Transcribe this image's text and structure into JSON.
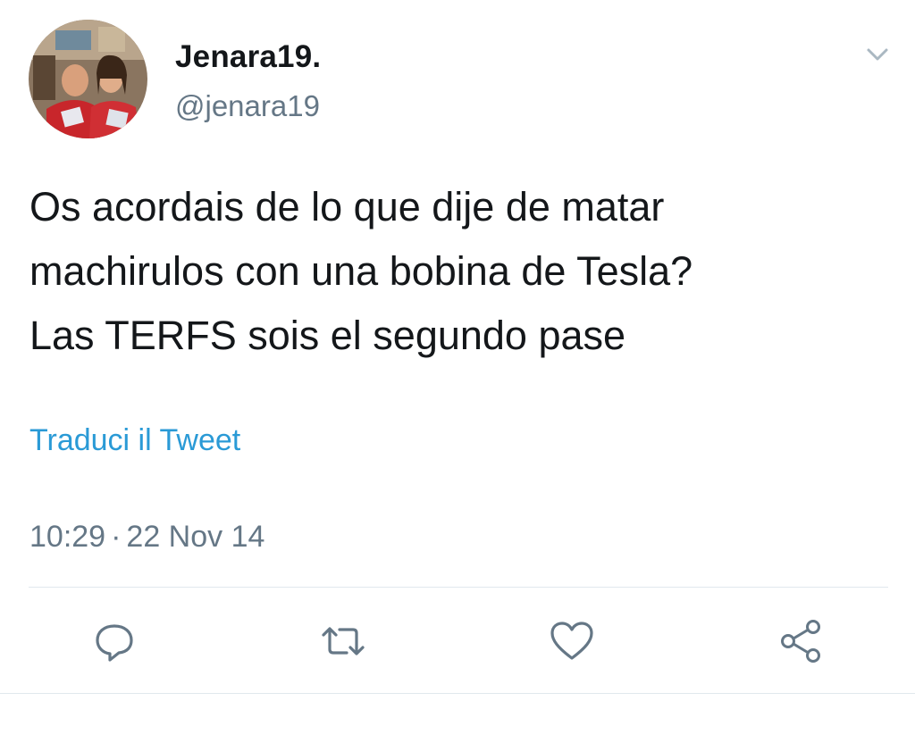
{
  "tweet": {
    "display_name": "Jenara19.",
    "handle": "@jenara19",
    "text_lines": [
      "Os acordais de lo que dije de matar",
      "machirulos con una bobina de Tesla?",
      "Las TERFS sois el segundo pase"
    ],
    "translate_label": "Traduci il Tweet",
    "time": "10:29",
    "separator": "·",
    "date": "22 Nov 14"
  },
  "icons": {
    "caret": "chevron-down-icon",
    "reply": "reply-icon",
    "retweet": "retweet-icon",
    "like": "heart-icon",
    "share": "share-icon"
  },
  "colors": {
    "text": "#14171a",
    "secondary": "#657786",
    "link": "#2a9ad6",
    "icon": "#657786",
    "divider": "#e1e8ed"
  }
}
